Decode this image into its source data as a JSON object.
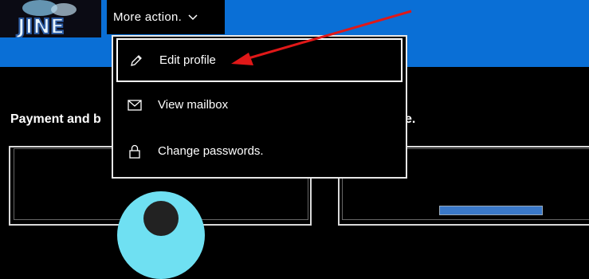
{
  "header": {
    "avatar_text": "JINE",
    "more_action_label": "More action.",
    "chevron_icon": "chevron-down-icon",
    "background_color": "#0a6fd6"
  },
  "content": {
    "title_visible_start": "Payment and b",
    "title_visible_end": "e."
  },
  "menu": {
    "items": [
      {
        "label": "Edit profile",
        "icon": "pencil-icon",
        "focused": true
      },
      {
        "label": "View mailbox",
        "icon": "mail-icon",
        "focused": false
      },
      {
        "label": "Change passwords.",
        "icon": "lock-icon",
        "focused": false
      }
    ]
  },
  "annotation": {
    "arrow_color": "#e01818",
    "points_to": "Edit profile"
  }
}
